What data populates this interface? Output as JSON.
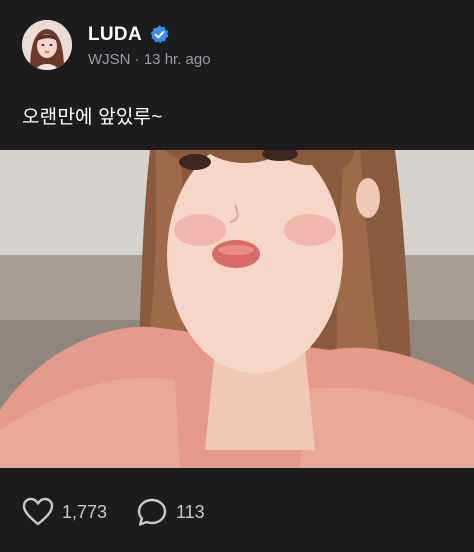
{
  "post": {
    "author": {
      "name": "LUDA",
      "verified": true,
      "group": "WJSN",
      "separator": "·",
      "time_ago": "13 hr. ago"
    },
    "text": "오랜만에 앞있루~",
    "photo": {
      "description_icon": "selfie-photo"
    },
    "stats": {
      "likes": "1,773",
      "comments": "113"
    }
  },
  "colors": {
    "background": "#1c1c1e",
    "verified_badge": "#3d8bf0",
    "muted_text": "#9b9ba1",
    "count_text": "#c9c9cd"
  },
  "icons": {
    "like": "heart-icon",
    "comment": "comment-bubble-icon",
    "verified": "verified-badge-icon"
  }
}
